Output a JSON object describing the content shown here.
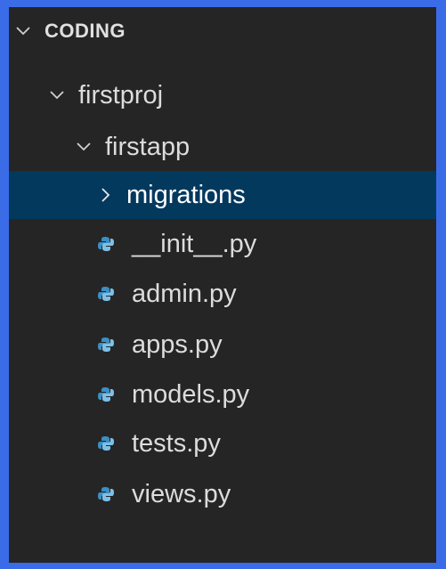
{
  "explorer": {
    "section_title": "CODING",
    "tree": {
      "project": {
        "label": "firstproj",
        "expanded": true
      },
      "app": {
        "label": "firstapp",
        "expanded": true
      },
      "migrations": {
        "label": "migrations",
        "expanded": false,
        "selected": true
      },
      "files": [
        {
          "label": "__init__.py",
          "icon": "python-file-icon"
        },
        {
          "label": "admin.py",
          "icon": "python-file-icon"
        },
        {
          "label": "apps.py",
          "icon": "python-file-icon"
        },
        {
          "label": "models.py",
          "icon": "python-file-icon"
        },
        {
          "label": "tests.py",
          "icon": "python-file-icon"
        },
        {
          "label": "views.py",
          "icon": "python-file-icon"
        }
      ]
    }
  },
  "colors": {
    "background_frame": "#3b6ce8",
    "panel_background": "#252526",
    "selected_row": "#04395e",
    "python_icon_blue": "#3d8fc2",
    "python_icon_light": "#7cc0e8"
  }
}
